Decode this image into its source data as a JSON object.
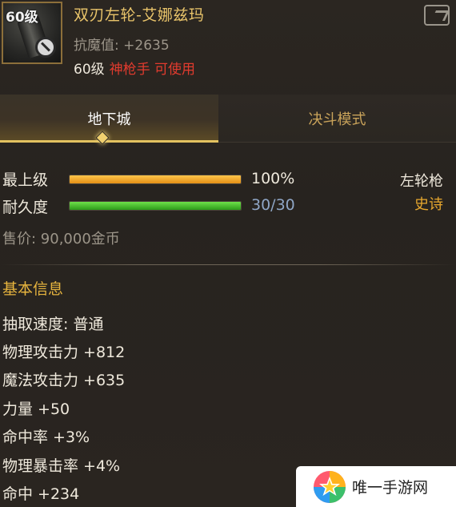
{
  "item": {
    "level_badge": "60级",
    "name": "双刃左轮-艾娜兹玛",
    "anti_magic": "抗魔值: +2635",
    "req_level": "60级",
    "req_class": "神枪手 可使用"
  },
  "tabs": [
    {
      "label": "地下城",
      "active": true
    },
    {
      "label": "决斗模式",
      "active": false
    }
  ],
  "stats": {
    "upgrade_label": "最上级",
    "upgrade_value": "100%",
    "upgrade_fraction": 1.0,
    "durability_label": "耐久度",
    "durability_value": "30/30",
    "durability_fraction": 1.0,
    "weapon_type": "左轮枪",
    "rarity": "史诗",
    "price": "售价: 90,000金币"
  },
  "basic_info": {
    "title": "基本信息",
    "attributes": [
      "抽取速度: 普通",
      "物理攻击力 +812",
      "魔法攻击力 +635",
      "力量 +50",
      "命中率 +3%",
      "物理暴击率 +4%",
      "命中 +234"
    ]
  },
  "watermark": {
    "text": "唯一手游网"
  },
  "colors": {
    "title_gold": "#e9c46a",
    "class_red": "#e23b2e",
    "rarity_orange": "#e6a72e",
    "bar_orange": "#e38f16",
    "bar_green": "#2c9a1a",
    "value_blue": "#8fa6c6"
  },
  "icons": [
    "revolver-item-icon",
    "ban-icon",
    "share-icon",
    "tab-indicator-icon",
    "watermark-logo-icon"
  ]
}
